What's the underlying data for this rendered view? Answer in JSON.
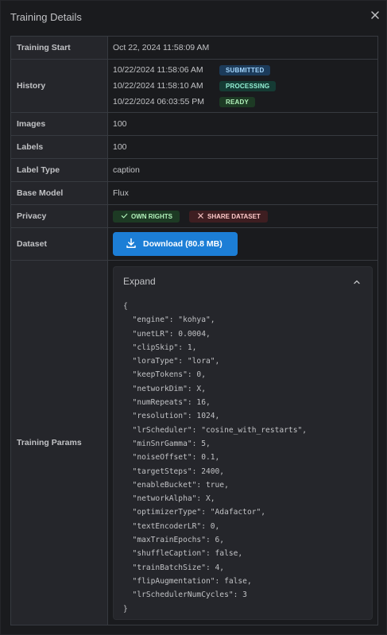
{
  "modal": {
    "title": "Training Details"
  },
  "rows": {
    "training_start": {
      "label": "Training Start",
      "value": "Oct 22, 2024 11:58:09 AM"
    },
    "history": {
      "label": "History",
      "items": [
        {
          "time": "10/22/2024 11:58:06 AM",
          "status": "SUBMITTED"
        },
        {
          "time": "10/22/2024 11:58:10 AM",
          "status": "PROCESSING"
        },
        {
          "time": "10/22/2024 06:03:55 PM",
          "status": "READY"
        }
      ]
    },
    "images": {
      "label": "Images",
      "value": "100"
    },
    "labels": {
      "label": "Labels",
      "value": "100"
    },
    "label_type": {
      "label": "Label Type",
      "value": "caption"
    },
    "base_model": {
      "label": "Base Model",
      "value": "Flux"
    },
    "privacy": {
      "label": "Privacy",
      "own_rights": "OWN RIGHTS",
      "share_dataset": "SHARE DATASET"
    },
    "dataset": {
      "label": "Dataset",
      "button": "Download (80.8 MB)"
    },
    "training_params": {
      "label": "Training Params",
      "accordion_title": "Expand",
      "json_lines": [
        "{",
        "  \"engine\": \"kohya\",",
        "  \"unetLR\": 0.0004,",
        "  \"clipSkip\": 1,",
        "  \"loraType\": \"lora\",",
        "  \"keepTokens\": 0,",
        "  \"networkDim\": X,",
        "  \"numRepeats\": 16,",
        "  \"resolution\": 1024,",
        "  \"lrScheduler\": \"cosine_with_restarts\",",
        "  \"minSnrGamma\": 5,",
        "  \"noiseOffset\": 0.1,",
        "  \"targetSteps\": 2400,",
        "  \"enableBucket\": true,",
        "  \"networkAlpha\": X,",
        "  \"optimizerType\": \"Adafactor\",",
        "  \"textEncoderLR\": 0,",
        "  \"maxTrainEpochs\": 6,",
        "  \"shuffleCaption\": false,",
        "  \"trainBatchSize\": 4,",
        "  \"flipAugmentation\": false,",
        "  \"lrSchedulerNumCycles\": 3",
        "}"
      ]
    }
  },
  "colors": {
    "background": "#1a1b1e",
    "label_cell": "#25262b",
    "border": "#373a40",
    "accent_button": "#1c7ed6",
    "submitted_badge": "#1c3b5a",
    "processing_badge": "#153b34",
    "ready_badge": "#1d3a24",
    "own_rights_badge": "#1d3a24",
    "share_dataset_badge": "#3e1e21"
  },
  "icons": {
    "close": "close-icon",
    "check": "check-icon",
    "x_mark": "x-icon",
    "download": "download-icon",
    "chevron": "chevron-up-icon"
  }
}
